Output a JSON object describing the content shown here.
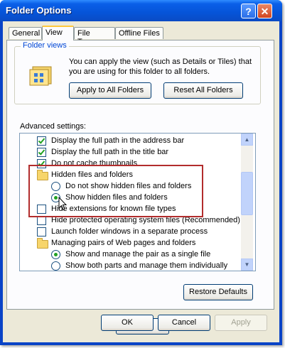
{
  "window": {
    "title": "Folder Options"
  },
  "titlebar": {
    "help_glyph": "?",
    "close_glyph": "✕"
  },
  "tabs": [
    {
      "label": "General"
    },
    {
      "label": "View",
      "active": true
    },
    {
      "label": "File Types"
    },
    {
      "label": "Offline Files"
    }
  ],
  "folder_views": {
    "group_label": "Folder views",
    "description": "You can apply the view (such as Details or Tiles) that you are using for this folder to all folders.",
    "apply_button": "Apply to All Folders",
    "reset_button": "Reset All Folders"
  },
  "advanced": {
    "label": "Advanced settings:",
    "items": [
      {
        "kind": "checkbox",
        "checked": true,
        "label": "Display the full path in the address bar"
      },
      {
        "kind": "checkbox",
        "checked": true,
        "label": "Display the full path in the title bar"
      },
      {
        "kind": "checkbox",
        "checked": true,
        "label": "Do not cache thumbnails"
      },
      {
        "kind": "folder",
        "label": "Hidden files and folders"
      },
      {
        "kind": "radio",
        "selected": false,
        "label": "Do not show hidden files and folders"
      },
      {
        "kind": "radio",
        "selected": true,
        "label": "Show hidden files and folders"
      },
      {
        "kind": "checkbox",
        "checked": false,
        "label": "Hide extensions for known file types"
      },
      {
        "kind": "checkbox",
        "checked": false,
        "label": "Hide protected operating system files (Recommended)"
      },
      {
        "kind": "checkbox",
        "checked": false,
        "label": "Launch folder windows in a separate process"
      },
      {
        "kind": "folder",
        "label": "Managing pairs of Web pages and folders"
      },
      {
        "kind": "radio",
        "selected": true,
        "label": "Show and manage the pair as a single file"
      },
      {
        "kind": "radio",
        "selected": false,
        "label": "Show both parts and manage them individually"
      }
    ],
    "restore_button": "Restore Defaults"
  },
  "footer": {
    "ok": "OK",
    "cancel": "Cancel",
    "apply": "Apply"
  },
  "colors": {
    "title_blue": "#0a5fe8",
    "group_label": "#0046d5",
    "highlight_box": "#b22d2d",
    "check_green": "#21a121"
  },
  "icons": [
    "help-icon",
    "close-icon",
    "folder-views-icon",
    "folder-icon",
    "checkbox-icon",
    "radio-icon",
    "mouse-pointer-icon"
  ]
}
